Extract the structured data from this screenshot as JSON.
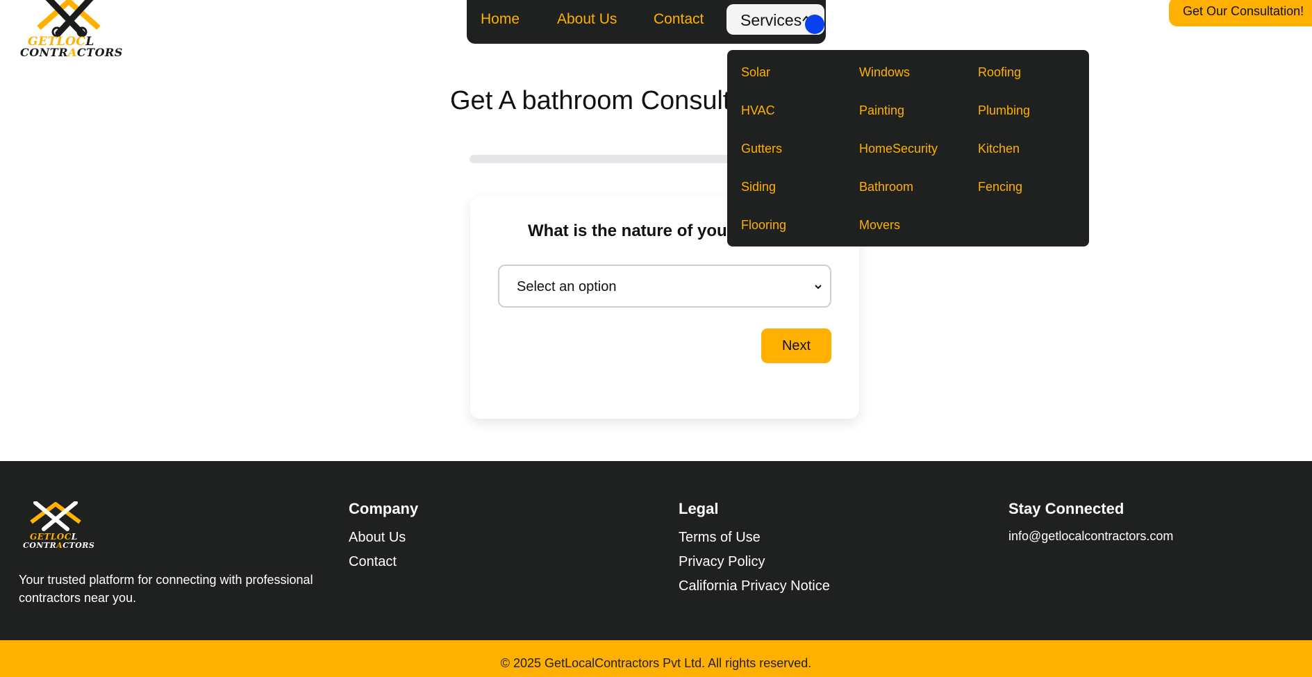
{
  "brand": {
    "logo_line1": "GETLOC",
    "logo_line1_end": "L",
    "logo_line2_start": "CONTR",
    "logo_line2_end": "CTORS",
    "accent": "#ffb000",
    "dark": "#1f2020"
  },
  "nav": {
    "items": [
      {
        "label": "Home"
      },
      {
        "label": "About Us"
      },
      {
        "label": "Contact"
      },
      {
        "label": "Services"
      }
    ]
  },
  "cta": {
    "label": "Get Our Consultation!"
  },
  "main": {
    "title": "Get A bathroom Consult",
    "question": "What is the nature of you",
    "select_value": "Select an option",
    "next_label": "Next"
  },
  "services_menu": {
    "columns": [
      [
        "Solar",
        "HVAC",
        "Gutters",
        "Siding",
        "Flooring"
      ],
      [
        "Windows",
        "Painting",
        "HomeSecurity",
        "Bathroom",
        "Movers"
      ],
      [
        "Roofing",
        "Plumbing",
        "Kitchen",
        "Fencing"
      ]
    ]
  },
  "footer": {
    "tagline": "Your trusted platform for connecting with professional contractors near you.",
    "company": {
      "heading": "Company",
      "links": [
        "About Us",
        "Contact"
      ]
    },
    "legal": {
      "heading": "Legal",
      "links": [
        "Terms of Use",
        "Privacy Policy",
        "California Privacy Notice"
      ]
    },
    "connect": {
      "heading": "Stay Connected",
      "email": "info@getlocalcontractors.com"
    },
    "copyright": "© 2025 GetLocalContractors Pvt Ltd. All rights reserved."
  }
}
